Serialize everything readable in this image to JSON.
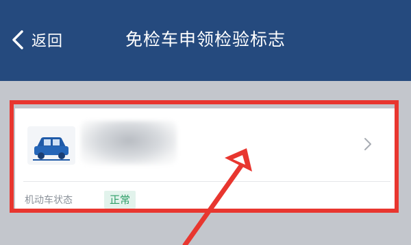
{
  "nav": {
    "back_label": "返回",
    "title": "免检车申领检验标志"
  },
  "vehicle_card": {
    "status_label": "机动车状态",
    "status_value": "正常"
  },
  "colors": {
    "nav_bg": "#254a7e",
    "page_bg": "#c3c6cc",
    "highlight": "#e8362f",
    "badge_bg": "#e2f3ec",
    "badge_text": "#2e9e67"
  },
  "icons": {
    "back": "chevron-left-icon",
    "vehicle": "car-icon",
    "detail": "chevron-right-icon"
  }
}
